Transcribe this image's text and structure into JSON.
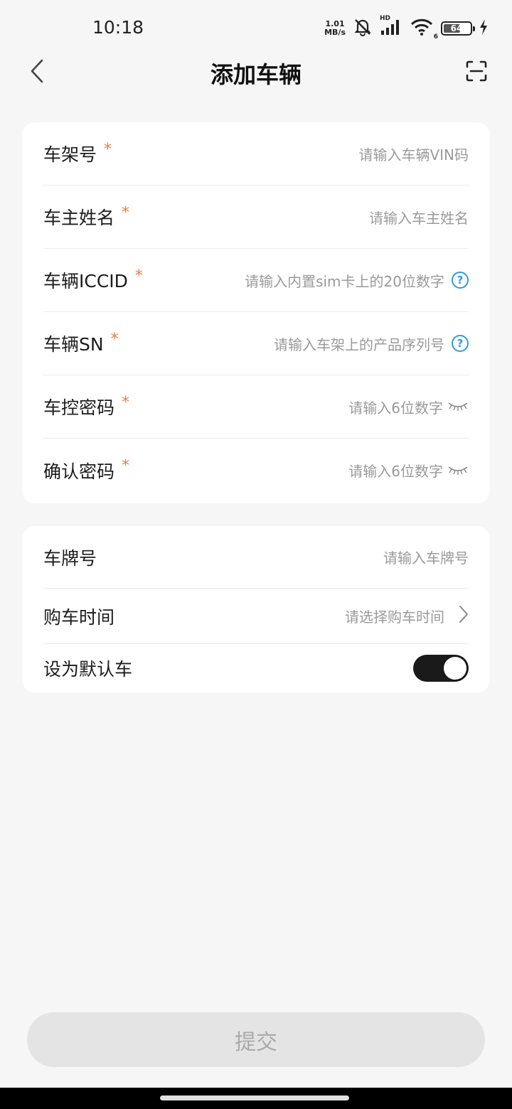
{
  "status_bar": {
    "time": "10:18",
    "net_speed_value": "1.01",
    "net_speed_unit": "MB/s",
    "signal_badge": "HD",
    "wifi_badge": "6",
    "battery": "64"
  },
  "header": {
    "title": "添加车辆",
    "back_icon": "chevron-left-icon",
    "scan_icon": "scan-icon"
  },
  "required_mark": "*",
  "form_required": [
    {
      "label": "车架号",
      "placeholder": "请输入车辆VIN码"
    },
    {
      "label": "车主姓名",
      "placeholder": "请输入车主姓名"
    },
    {
      "label": "车辆ICCID",
      "placeholder": "请输入内置sim卡上的20位数字",
      "help": "?"
    },
    {
      "label": "车辆SN",
      "placeholder": "请输入车架上的产品序列号",
      "help": "?"
    },
    {
      "label": "车控密码",
      "placeholder": "请输入6位数字"
    },
    {
      "label": "确认密码",
      "placeholder": "请输入6位数字"
    }
  ],
  "form_optional": {
    "plate": {
      "label": "车牌号",
      "placeholder": "请输入车牌号"
    },
    "purchase_time": {
      "label": "购车时间",
      "placeholder": "请选择购车时间"
    },
    "default_car": {
      "label": "设为默认车",
      "enabled": true
    }
  },
  "submit_label": "提交",
  "colors": {
    "required": "#f07a3e",
    "help": "#2e9be0",
    "toggle_on": "#1a1a1a",
    "background": "#f5f6f5"
  }
}
